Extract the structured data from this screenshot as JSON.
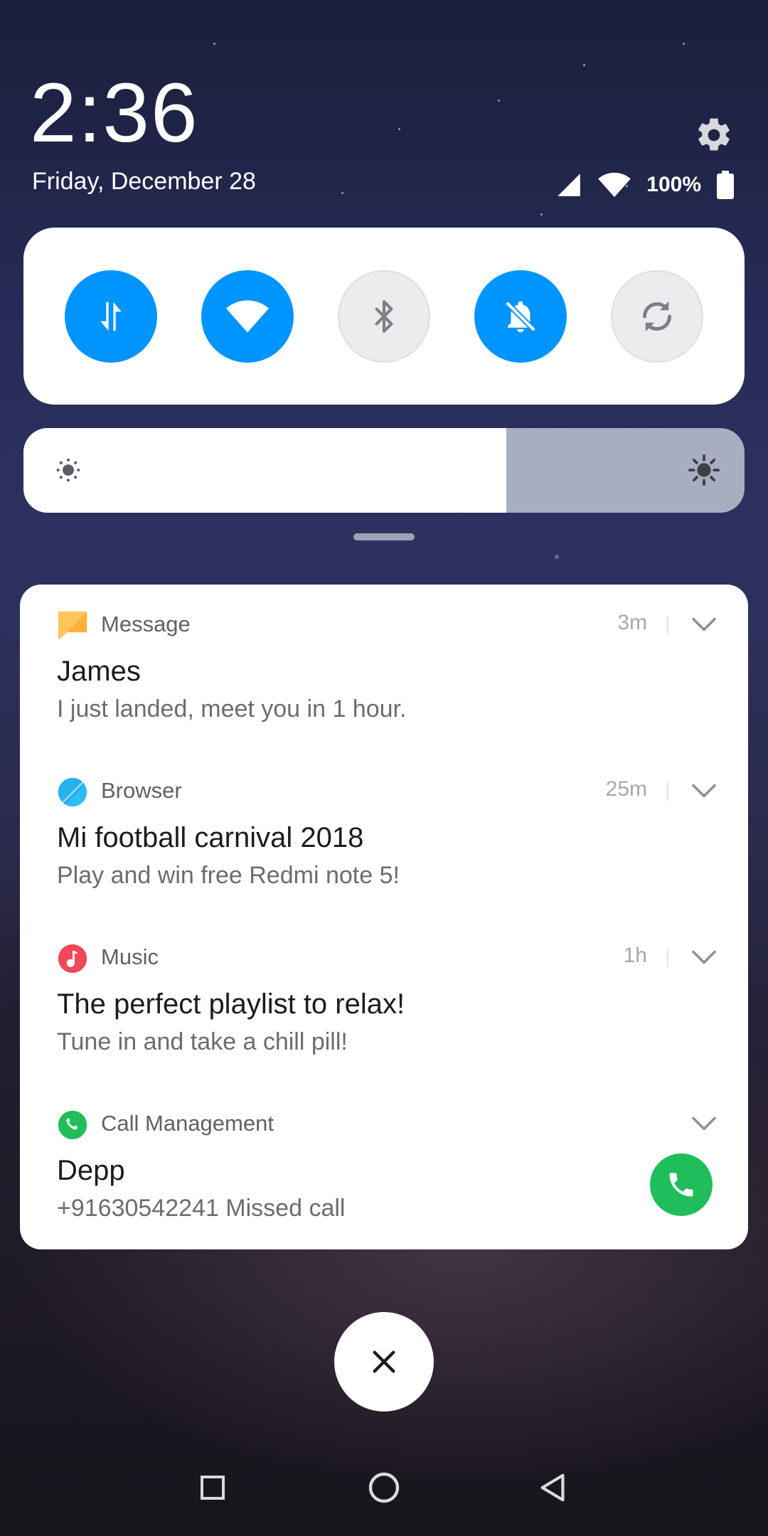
{
  "header": {
    "time": "2:36",
    "date": "Friday, December 28",
    "battery_percent": "100%",
    "settings_icon": "gear-icon",
    "signal_icon": "cellular-signal-icon",
    "wifi_icon": "wifi-icon",
    "battery_icon": "battery-full-icon"
  },
  "quick_toggles": [
    {
      "name": "mobile-data",
      "icon": "mobile-data-arrows-icon",
      "active": true
    },
    {
      "name": "wifi",
      "icon": "wifi-icon",
      "active": true
    },
    {
      "name": "bluetooth",
      "icon": "bluetooth-icon",
      "active": false
    },
    {
      "name": "silent",
      "icon": "bell-off-icon",
      "active": true
    },
    {
      "name": "auto-rotate",
      "icon": "rotate-icon",
      "active": false
    }
  ],
  "brightness": {
    "level": 0.67,
    "low_icon": "sun-low-icon",
    "high_icon": "sun-high-icon"
  },
  "notifications": [
    {
      "app": "Message",
      "time": "3m",
      "title": "James",
      "body": "I just landed, meet you in 1 hour.",
      "icon": "message-icon",
      "color": "#ffc55c"
    },
    {
      "app": "Browser",
      "time": "25m",
      "title": "Mi football carnival 2018",
      "body": "Play and win free Redmi note 5!",
      "icon": "browser-icon",
      "color": "#2dbdf5"
    },
    {
      "app": "Music",
      "time": "1h",
      "title": "The perfect playlist to relax!",
      "body": "Tune in and take a chill pill!",
      "icon": "music-icon",
      "color": "#f0485a"
    },
    {
      "app": "Call Management",
      "time": "",
      "title": "Depp",
      "body": "+91630542241 Missed call",
      "icon": "phone-icon",
      "color": "#1fbe5a"
    }
  ],
  "colors": {
    "accent": "#0094ff",
    "call_green": "#1fbe5a"
  },
  "clear_button_icon": "close-icon",
  "nav": [
    "recents-icon",
    "home-icon",
    "back-icon"
  ]
}
